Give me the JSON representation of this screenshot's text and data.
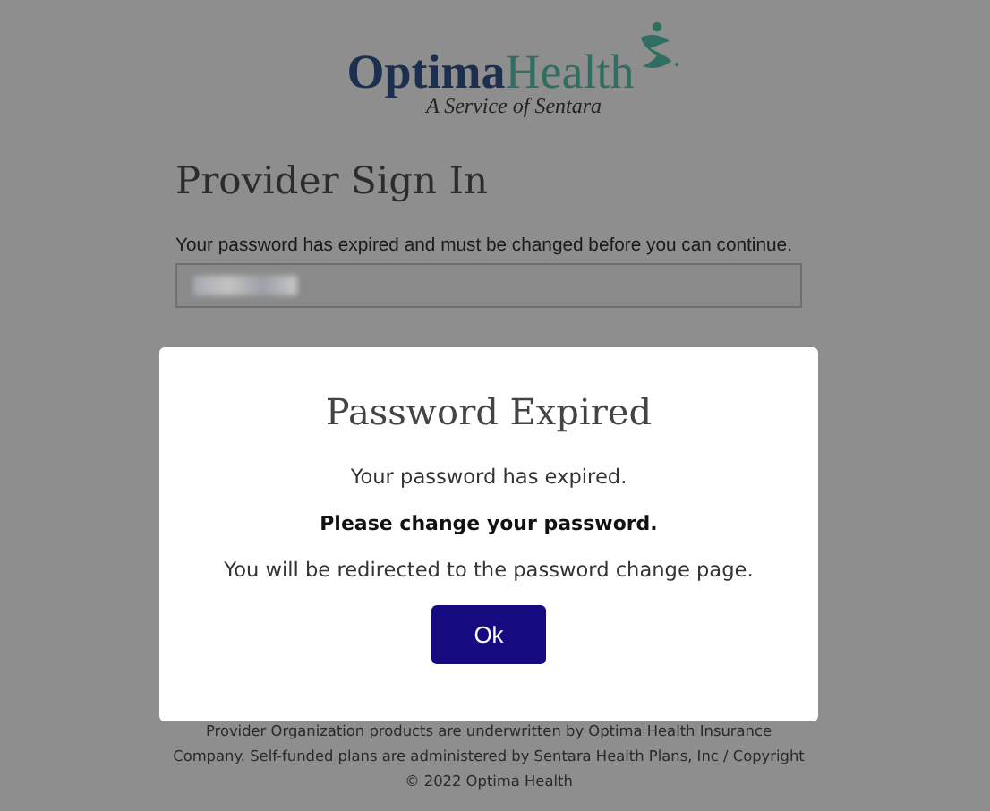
{
  "logo": {
    "name_part_1": "Optima",
    "name_part_2": "Health",
    "tagline": "A Service of Sentara"
  },
  "heading": "Provider Sign In",
  "message": "Your password has expired and must be changed before you can continue.",
  "footer": [
    "Provider Organization products are underwritten by Optima Health Insurance",
    "Company. Self-funded plans are administered by Sentara Health Plans, Inc / Copyright",
    "© 2022 Optima Health"
  ],
  "dialog": {
    "title": "Password Expired",
    "lines": [
      {
        "text": "Your password has expired.",
        "kind": "plain"
      },
      {
        "text": "Please change your password.",
        "kind": "strong"
      },
      {
        "text": "You will be redirected to the password change page.",
        "kind": "plain"
      }
    ],
    "button": "Ok"
  }
}
